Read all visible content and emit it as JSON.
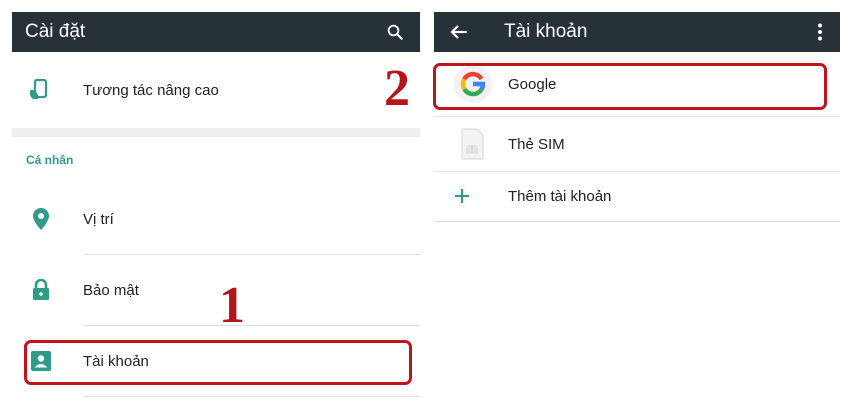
{
  "colors": {
    "appbar": "#263238",
    "accent_teal": "#2e9c88",
    "highlight_red": "#c0141b",
    "step_number": "#b3151b"
  },
  "left": {
    "title": "Cài đặt",
    "action_icon": "search-icon",
    "advanced_item": {
      "label": "Tương tác nâng cao",
      "icon": "hand-phone-icon"
    },
    "section_header": "Cá nhân",
    "items": [
      {
        "label": "Vị trí",
        "icon": "location-pin-icon"
      },
      {
        "label": "Bảo mật",
        "icon": "lock-icon"
      },
      {
        "label": "Tài khoản",
        "icon": "account-box-icon",
        "highlighted": true
      }
    ]
  },
  "right": {
    "title": "Tài khoản",
    "nav_icon": "back-arrow-icon",
    "menu_icon": "overflow-menu-icon",
    "items": [
      {
        "label": "Google",
        "icon": "google-icon",
        "highlighted": true
      },
      {
        "label": "Thẻ SIM",
        "icon": "sim-card-icon"
      },
      {
        "label": "Thêm tài khoản",
        "icon": "plus-icon"
      }
    ]
  },
  "annotations": {
    "step1": "1",
    "step2": "2"
  }
}
